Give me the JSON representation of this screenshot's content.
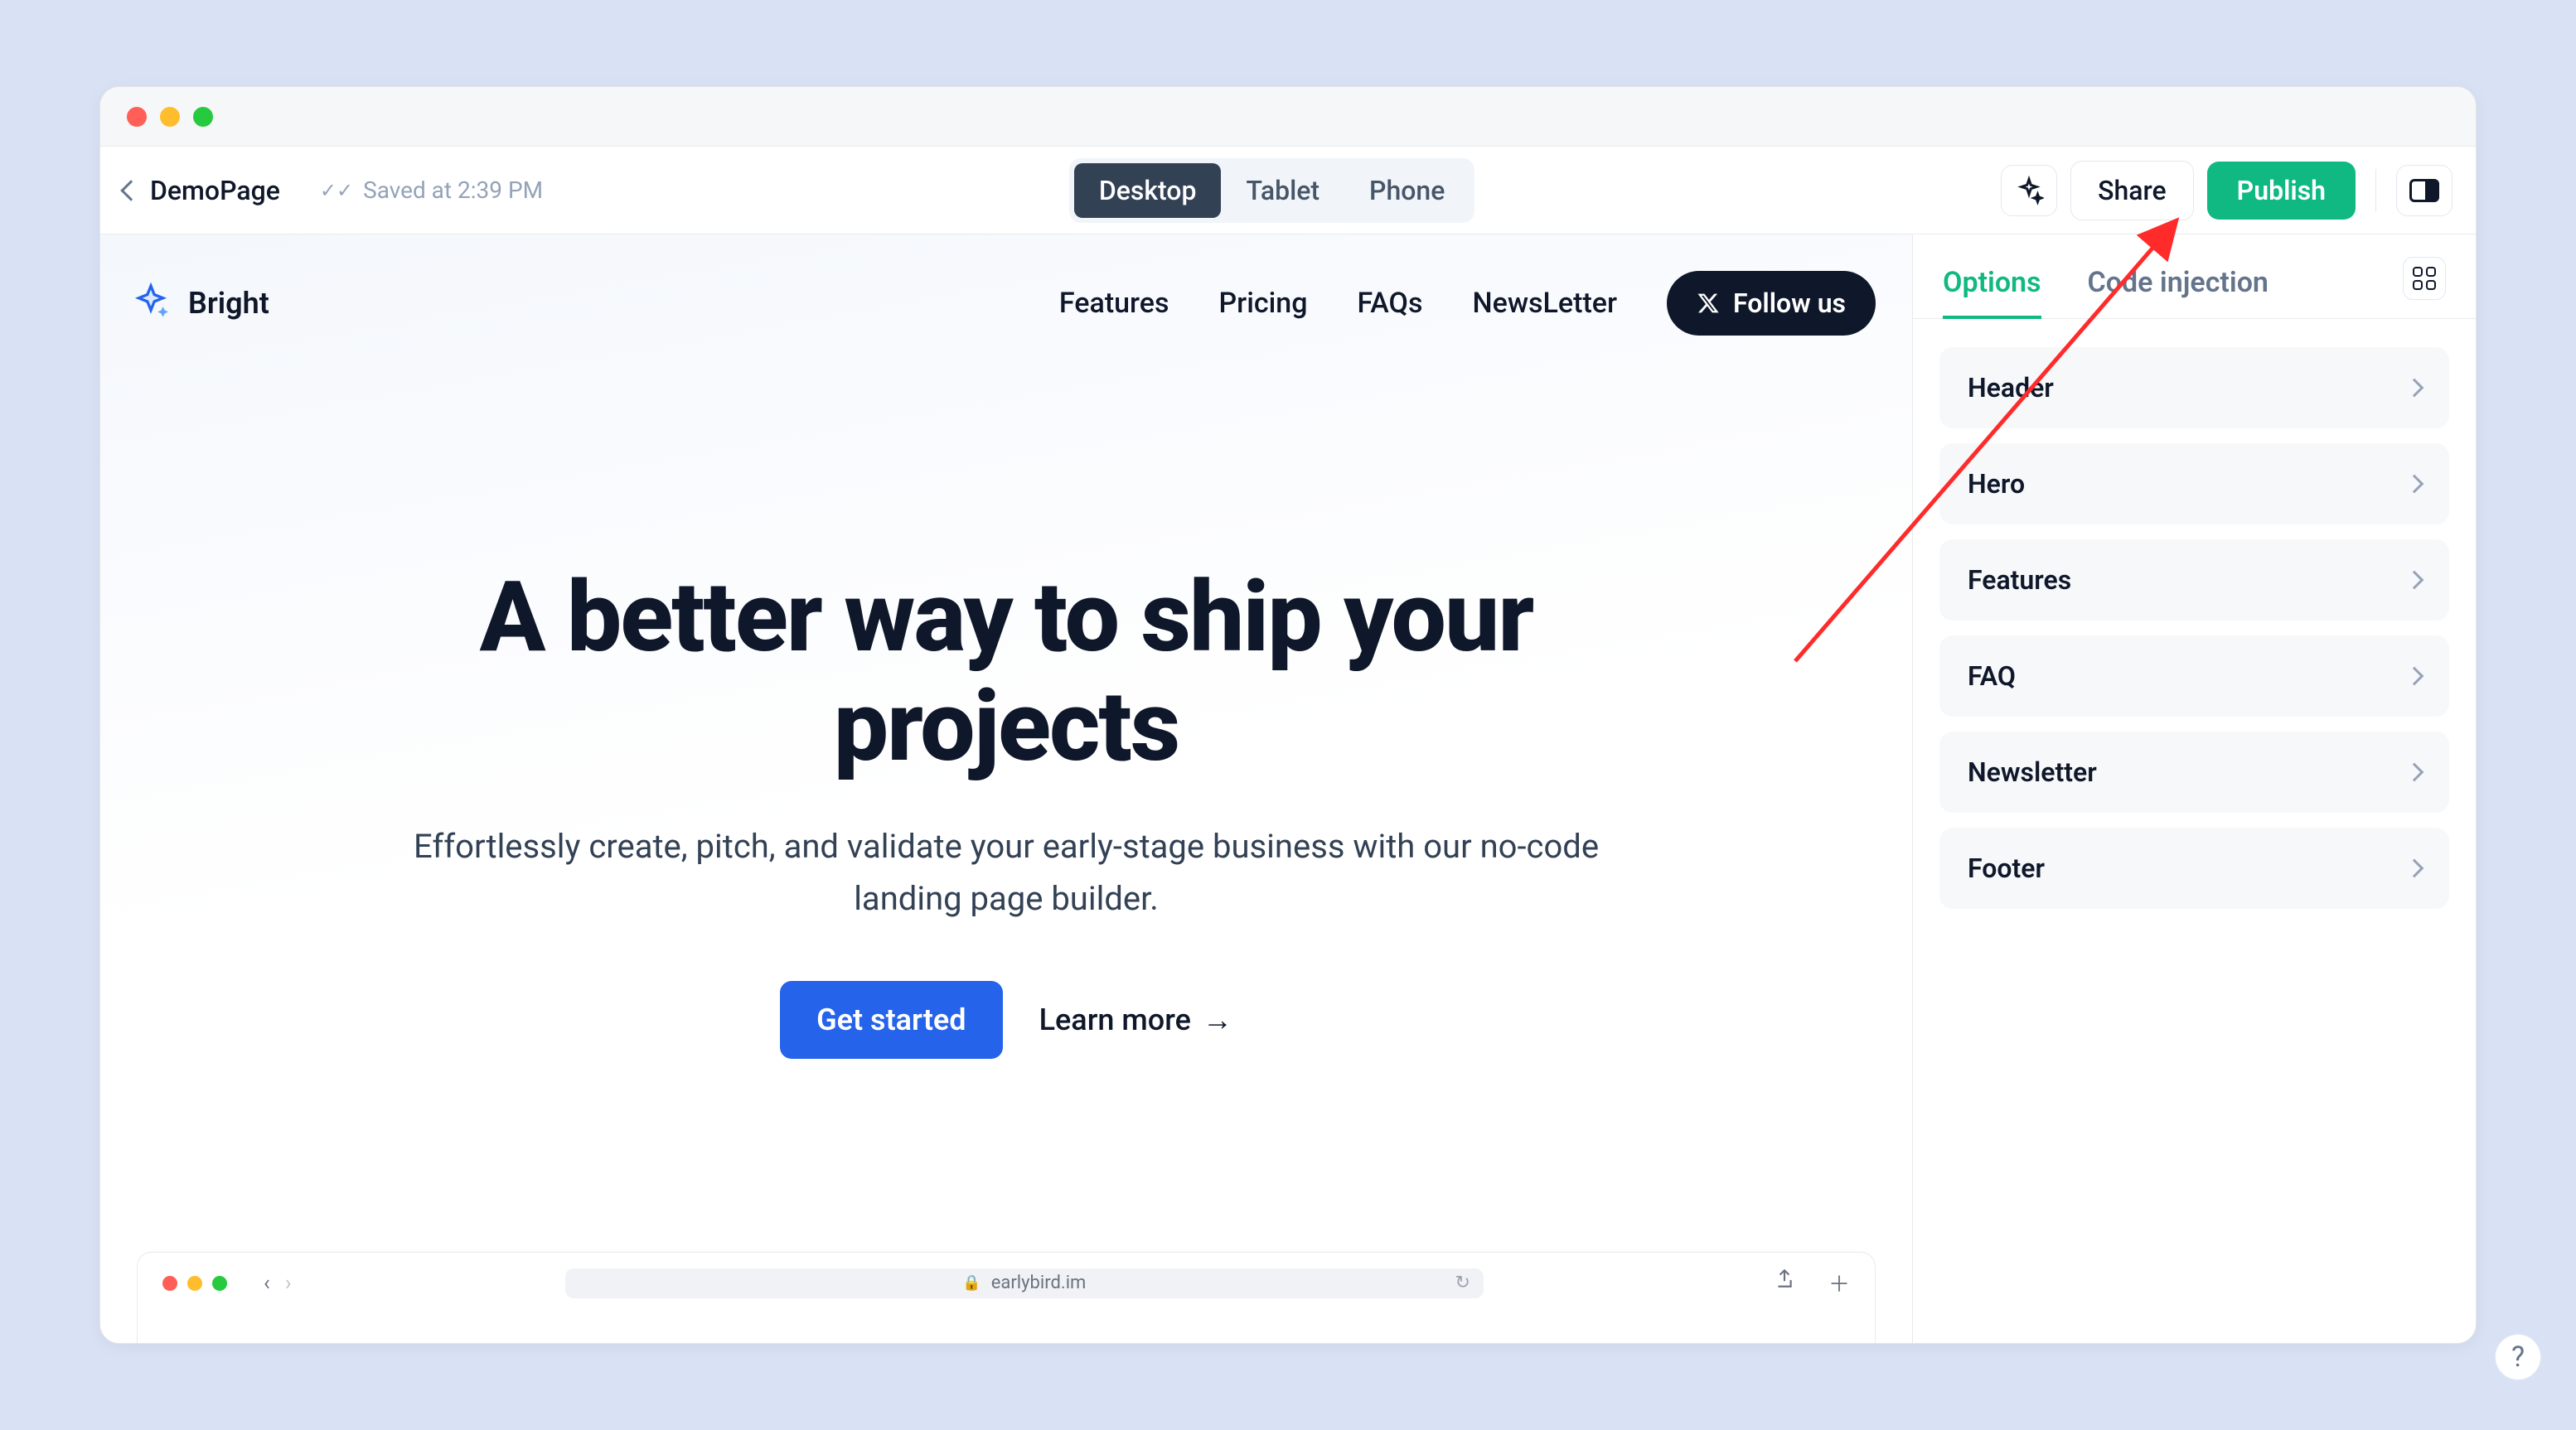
{
  "toolbar": {
    "page_name": "DemoPage",
    "saved_status": "Saved at 2:39 PM",
    "devices": {
      "desktop": "Desktop",
      "tablet": "Tablet",
      "phone": "Phone"
    },
    "share_label": "Share",
    "publish_label": "Publish"
  },
  "site": {
    "brand": "Bright",
    "nav": {
      "features": "Features",
      "pricing": "Pricing",
      "faqs": "FAQs",
      "newsletter": "NewsLetter"
    },
    "follow_label": "Follow us",
    "hero": {
      "headline": "A better way to ship your projects",
      "subhead": "Effortlessly create, pitch, and validate your early-stage business with our no-code landing page builder.",
      "cta_primary": "Get started",
      "cta_secondary": "Learn more"
    },
    "mock_url": "earlybird.im"
  },
  "sidebar": {
    "tabs": {
      "options": "Options",
      "code_injection": "Code injection"
    },
    "items": [
      {
        "label": "Header"
      },
      {
        "label": "Hero"
      },
      {
        "label": "Features"
      },
      {
        "label": "FAQ"
      },
      {
        "label": "Newsletter"
      },
      {
        "label": "Footer"
      }
    ]
  },
  "help_label": "?"
}
